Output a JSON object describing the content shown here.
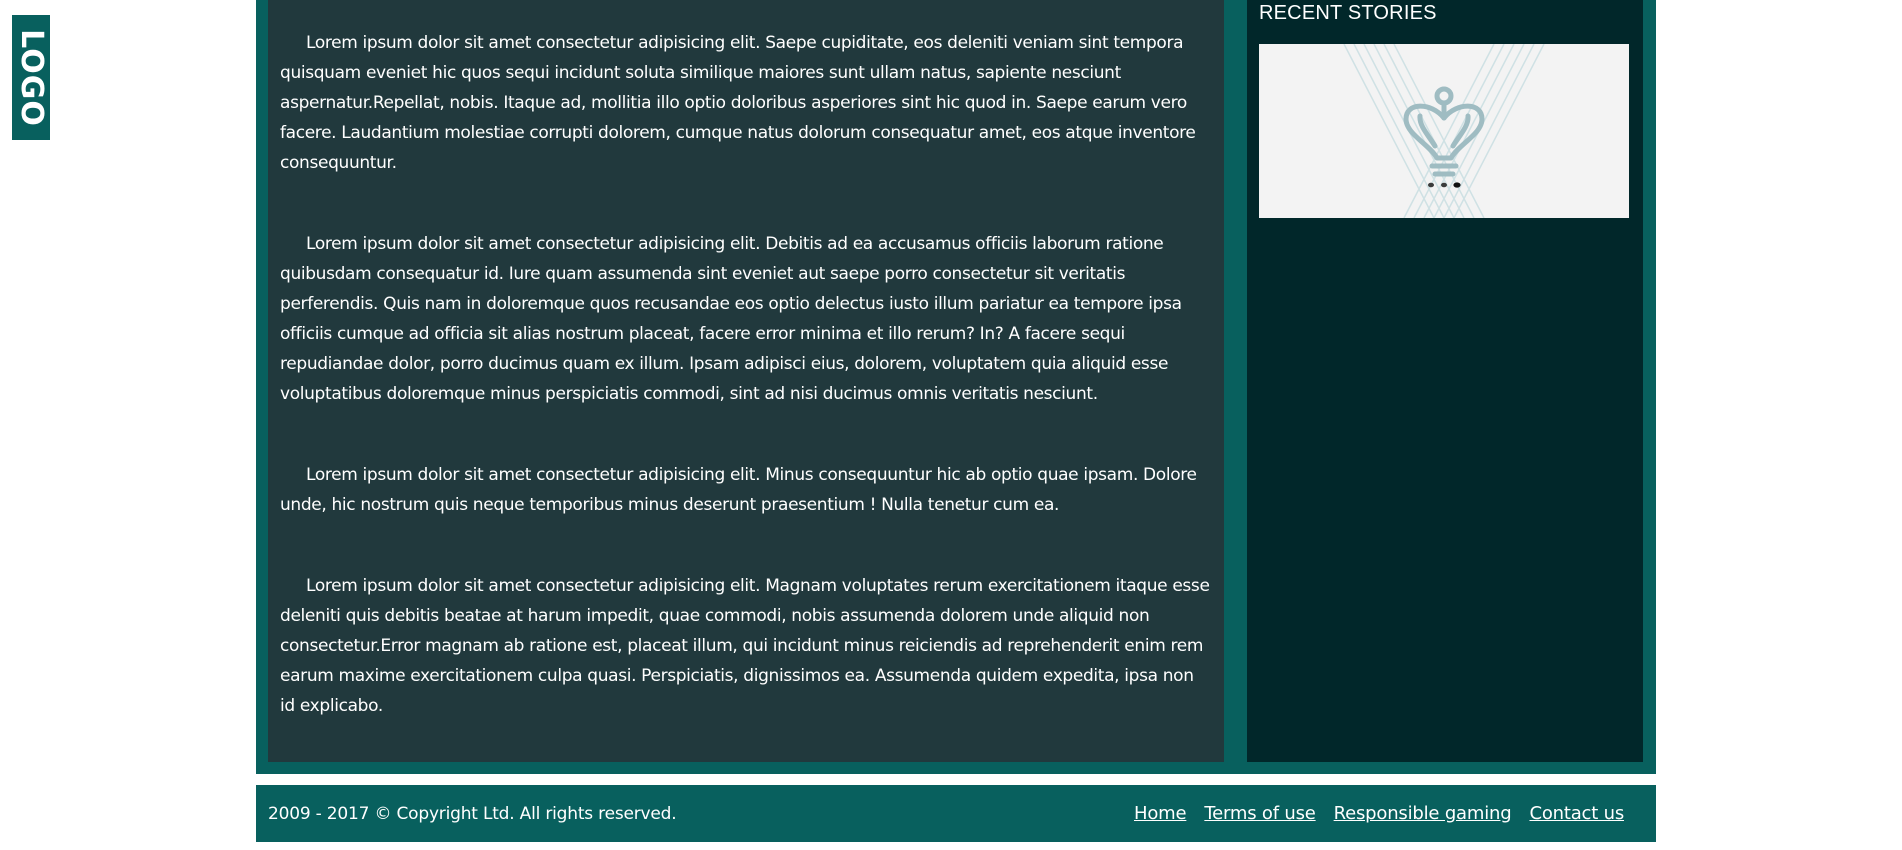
{
  "logo": {
    "text": "LOGO"
  },
  "article": {
    "paragraphs": [
      "Lorem ipsum dolor sit amet consectetur adipisicing elit. Saepe cupiditate, eos deleniti veniam sint tempora quisquam eveniet hic quos sequi incidunt soluta similique maiores sunt ullam natus, sapiente nesciunt aspernatur.Repellat, nobis. Itaque ad, mollitia illo optio doloribus asperiores sint hic quod in. Saepe earum vero facere. Laudantium molestiae corrupti dolorem, cumque natus dolorum consequatur amet, eos atque inventore consequuntur.",
      "Lorem ipsum dolor sit amet consectetur adipisicing elit. Debitis ad ea accusamus officiis laborum ratione quibusdam consequatur id. Iure quam assumenda sint eveniet aut saepe porro consectetur sit veritatis perferendis. Quis nam in doloremque quos recusandae eos optio delectus iusto illum pariatur ea tempore ipsa officiis cumque ad officia sit alias nostrum placeat, facere error minima et illo rerum? In? A facere sequi repudiandae dolor, porro ducimus quam ex illum. Ipsam adipisci eius, dolorem, voluptatem quia aliquid esse voluptatibus doloremque minus perspiciatis commodi, sint ad nisi ducimus omnis veritatis nesciunt.",
      "Lorem ipsum dolor sit amet consectetur adipisicing elit. Minus consequuntur hic ab optio quae ipsam. Dolore unde, hic nostrum quis neque temporibus minus deserunt praesentium ! Nulla tenetur cum ea.",
      "Lorem ipsum dolor sit amet consectetur adipisicing elit. Magnam voluptates rerum exercitationem itaque esse deleniti quis debitis beatae at harum impedit, quae commodi, nobis assumenda dolorem unde aliquid non consectetur.Error magnam ab ratione est, placeat illum, qui incidunt minus reiciendis ad reprehenderit enim rem earum maxime exercitationem culpa quasi. Perspiciatis, dignissimos ea. Assumenda quidem expedita, ipsa non id explicabo."
    ]
  },
  "sidebar": {
    "title": "RECENT STORIES",
    "story_image": {
      "icon": "crown-logo-icon",
      "loading_dots_icon": "loading-dots-icon"
    }
  },
  "footer": {
    "copyright": "2009 - 2017 © Copyright Ltd. All rights reserved.",
    "links": [
      "Home",
      "Terms of use",
      "Responsible gaming",
      "Contact us"
    ]
  },
  "colors": {
    "brand_teal": "#08605e",
    "content_bg": "#21393d",
    "sidebar_bg": "#01272a",
    "card_bg": "#f3f3f3",
    "text": "#ffffff"
  }
}
